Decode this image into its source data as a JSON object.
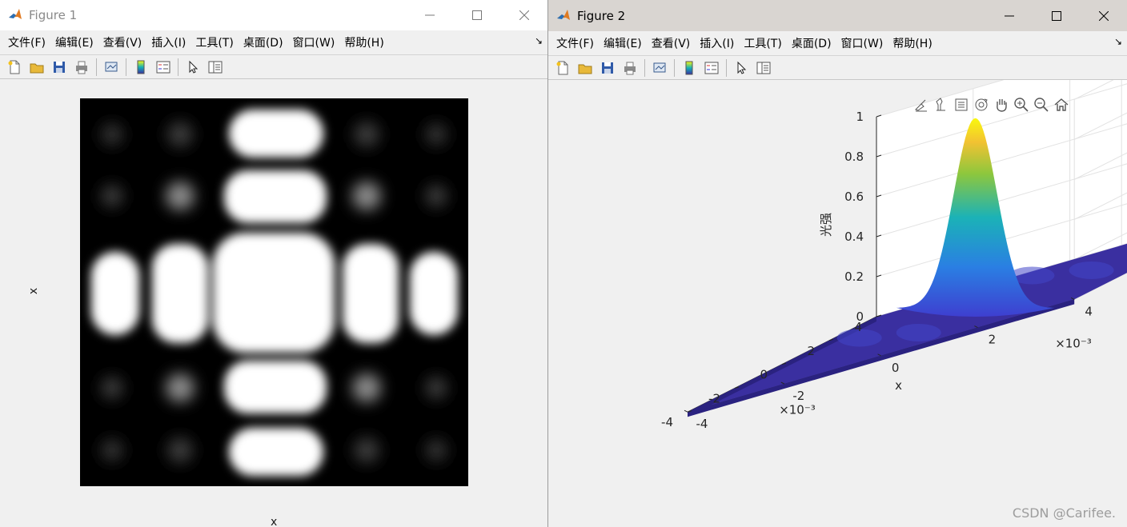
{
  "menu_labels": [
    "文件(F)",
    "编辑(E)",
    "查看(V)",
    "插入(I)",
    "工具(T)",
    "桌面(D)",
    "窗口(W)",
    "帮助(H)"
  ],
  "window1": {
    "title": "Figure 1",
    "image_axis_label_left": "x",
    "image_axis_label_bottom": "x"
  },
  "window2": {
    "title": "Figure 2",
    "axes_toolbar_icons": [
      "brush-icon",
      "datatip-icon",
      "legend-icon",
      "rotate-icon",
      "pan-icon",
      "zoom-in-icon",
      "zoom-out-icon",
      "home-icon"
    ]
  },
  "toolbar_icons": [
    "new-figure-icon",
    "open-icon",
    "save-icon",
    "print-icon",
    "link-plot-icon",
    "colorbar-icon",
    "legend-icon",
    "pointer-icon",
    "property-editor-icon"
  ],
  "chart_data": {
    "type": "surface",
    "zlabel": "光强",
    "xlabel": "x",
    "z_ticks": [
      "0",
      "0.2",
      "0.4",
      "0.6",
      "0.8",
      "1"
    ],
    "x_ticks": [
      "-4",
      "-2",
      "0",
      "2",
      "4"
    ],
    "y_ticks": [
      "-4",
      "-2",
      "0",
      "2",
      "4"
    ],
    "x_exponent": "×10⁻³",
    "y_exponent": "×10⁻³",
    "xlim": [
      -4,
      4
    ],
    "ylim": [
      -4,
      4
    ],
    "zlim": [
      0,
      1
    ],
    "peak": {
      "x": 0,
      "y": 0,
      "z": 0.95
    },
    "colormap": "parula",
    "colors": {
      "low": "#3a2fa0",
      "mid": "#14b1b8",
      "high": "#f9f80e"
    }
  },
  "watermark": "CSDN @Carifee."
}
